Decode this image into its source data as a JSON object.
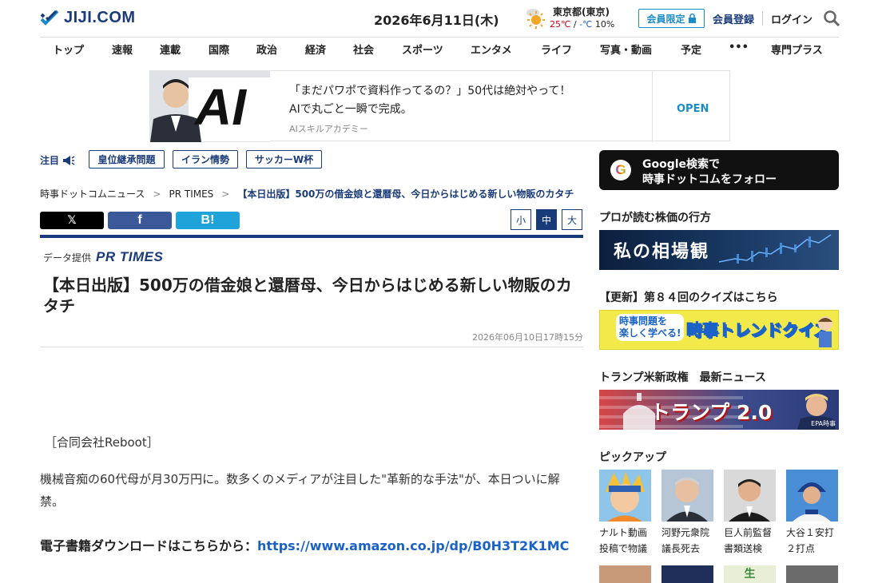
{
  "header": {
    "logo_text": "JIJI.COM",
    "date": "2026年6月11日(木)",
    "weather": {
      "location": "東京都(東京)",
      "high": "25℃",
      "slash": " / ",
      "low": "-℃",
      "precip": "10%",
      "icon": "sun-icon"
    },
    "member_badge": "会員限定",
    "register": "会員登録",
    "login": "ログイン"
  },
  "nav": {
    "items": [
      "トップ",
      "速報",
      "連載",
      "国際",
      "政治",
      "経済",
      "社会",
      "スポーツ",
      "エンタメ",
      "ライフ",
      "写真・動画",
      "予定",
      "•••",
      "専門プラス"
    ]
  },
  "ad": {
    "line1": "「まだパワポで資料作ってるの？」50代は絶対やって！",
    "line2": "AIで丸ごと一瞬で完成。",
    "source": "AIスキルアカデミー",
    "open": "OPEN",
    "image_text": "AI"
  },
  "attention": {
    "label": "注目",
    "tags": [
      "皇位継承問題",
      "イラン情勢",
      "サッカーW杯"
    ]
  },
  "breadcrumb": {
    "items": [
      "時事ドットコムニュース",
      "PR TIMES",
      "【本日出版】500万の借金娘と還暦母、今日からはじめる新しい物販のカタチ"
    ],
    "separator": ">"
  },
  "share": {
    "x": "𝕏",
    "facebook": "f",
    "hatena": "B!"
  },
  "font_size": {
    "small": "小",
    "medium": "中",
    "large": "大"
  },
  "article": {
    "provider_label": "データ提供",
    "provider_name": "PR TIMES",
    "title": "【本日出版】500万の借金娘と還暦母、今日からはじめる新しい物販のカタチ",
    "timestamp": "2026年06月10日17時15分",
    "company": "［合同会社Reboot］",
    "paragraph1": "機械音痴の60代母が月30万円に。数多くのメディアが注目した\"革新的な手法\"が、本日ついに解禁。",
    "download_label": "電子書籍ダウンロードはこちらから：",
    "download_url": "https://www.amazon.co.jp/dp/B0H3T2K1MC"
  },
  "sidebar": {
    "google_line1": "Google検索で",
    "google_line2": "時事ドットコムをフォロー",
    "google_letter": "G",
    "h1": "プロが読む株価の行方",
    "banner1": "私の相場観",
    "h2": "【更新】第８４回のクイズはこちら",
    "banner2_title": "時事トレンドクイズ",
    "banner2_sub1": "時事問題を",
    "banner2_sub2": "楽しく学べる!",
    "h3": "トランプ米新政権　最新ニュース",
    "banner3": "トランプ 2.0",
    "banner3_credit": "EPA時事",
    "h4": "ピックアップ",
    "picks": [
      {
        "line1": "ナルト動画",
        "line2": "投稿で物議"
      },
      {
        "line1": "河野元衆院",
        "line2": "議長死去"
      },
      {
        "line1": "巨人前監督",
        "line2": "書類送検"
      },
      {
        "line1": "大谷１安打",
        "line2": "２打点"
      }
    ],
    "pick5_text": "生"
  },
  "colors": {
    "brand": "#1a3b7a",
    "accent": "#1a8cc7",
    "link": "#1a62c7"
  }
}
